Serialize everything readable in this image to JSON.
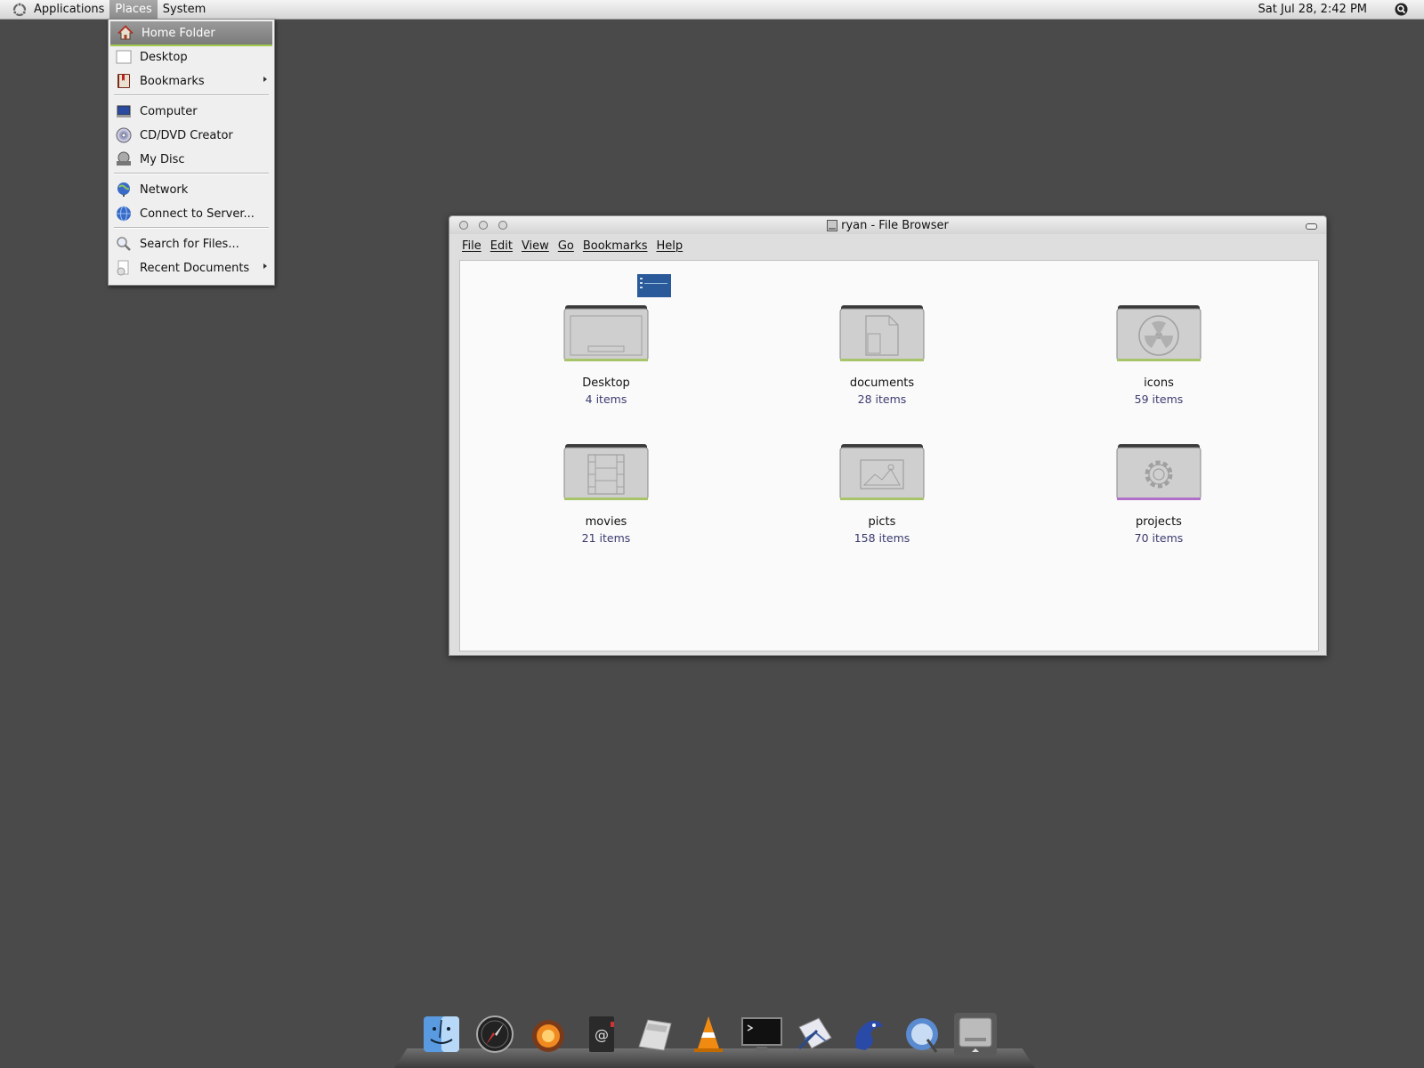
{
  "panel": {
    "menus": [
      "Applications",
      "Places",
      "System"
    ],
    "clock": "Sat Jul 28, 2:42 PM"
  },
  "places_menu": {
    "items": [
      {
        "label": "Home Folder",
        "icon": "home-icon",
        "selected": true
      },
      {
        "label": "Desktop",
        "icon": "desktop-icon"
      },
      {
        "label": "Bookmarks",
        "icon": "bookmarks-icon",
        "submenu": true
      },
      {
        "label": "Computer",
        "icon": "computer-icon"
      },
      {
        "label": "CD/DVD Creator",
        "icon": "cd-icon"
      },
      {
        "label": "My Disc",
        "icon": "disc-icon"
      },
      {
        "label": "Network",
        "icon": "network-icon"
      },
      {
        "label": "Connect to Server...",
        "icon": "globe-icon"
      },
      {
        "label": "Search for Files...",
        "icon": "search-icon"
      },
      {
        "label": "Recent Documents",
        "icon": "recent-documents-icon",
        "submenu": true
      }
    ]
  },
  "window": {
    "title": "ryan - File Browser",
    "menus": [
      "File",
      "Edit",
      "View",
      "Go",
      "Bookmarks",
      "Help"
    ],
    "folders": [
      {
        "name": "Desktop",
        "count": "4 items",
        "emblem": "desktop-emblem-icon",
        "accent": "#a8c46a"
      },
      {
        "name": "documents",
        "count": "28 items",
        "emblem": "document-emblem-icon",
        "accent": "#a8c46a"
      },
      {
        "name": "icons",
        "count": "59 items",
        "emblem": "radiation-emblem-icon",
        "accent": "#a8c46a"
      },
      {
        "name": "movies",
        "count": "21 items",
        "emblem": "film-emblem-icon",
        "accent": "#a8c46a"
      },
      {
        "name": "picts",
        "count": "158 items",
        "emblem": "picture-emblem-icon",
        "accent": "#a8c46a"
      },
      {
        "name": "projects",
        "count": "70 items",
        "emblem": "gear-emblem-icon",
        "accent": "#b070c8"
      }
    ]
  },
  "dock": {
    "items": [
      "finder-icon",
      "compass-icon",
      "firefox-icon",
      "address-book-icon",
      "calculator-icon",
      "vlc-cone-icon",
      "terminal-icon",
      "mail-icon",
      "dolphin-icon",
      "thunderbird-icon",
      "hard-drive-icon"
    ]
  }
}
